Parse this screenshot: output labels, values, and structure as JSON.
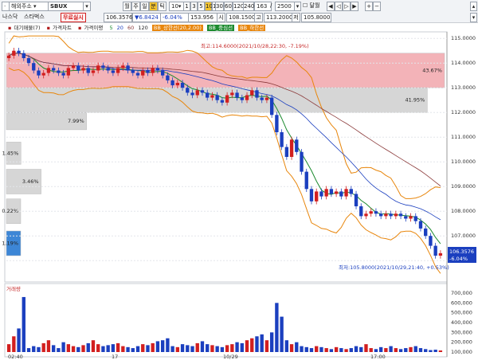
{
  "toolbar": {
    "market_label": "해외주소",
    "symbol": "SBUX",
    "period_buttons": [
      "월",
      "주",
      "일",
      "분",
      "틱"
    ],
    "interval_value": "10",
    "interval_options": [
      "1",
      "3",
      "5",
      "10",
      "15",
      "30",
      "60",
      "120",
      "240"
    ],
    "count_value": "163",
    "range_value": "2500",
    "overlay_label": "달월",
    "exchange_label": "나스닥",
    "name": "스타벅스",
    "free_realtime": "무료실시",
    "price": "106.3576",
    "change": "▼6.8424",
    "change_pct": "-6.04%",
    "volume": "153.956",
    "open_label": "시",
    "open": "108.1500",
    "high_label": "고",
    "high": "113.2000",
    "low_label": "저",
    "low": "105.8000"
  },
  "legend": {
    "items": [
      {
        "text": "대기매물(7)",
        "color": "#333333"
      },
      {
        "text": "가격차트",
        "color": "#333333"
      },
      {
        "text": "가격이평",
        "color": "#1b8a2e"
      },
      {
        "text": "5",
        "color": "#1b8a2e"
      },
      {
        "text": "20",
        "color": "#1b3fbf"
      },
      {
        "text": "60",
        "color": "#8b3a3a"
      },
      {
        "text": "120",
        "color": "#333333"
      },
      {
        "text": "BB_상한선(20,2.00)",
        "color": "#e8860c"
      },
      {
        "text": "BB_중심선",
        "color": "#1b8a2e"
      },
      {
        "text": "BB_하한선",
        "color": "#e8860c"
      }
    ]
  },
  "annotations": {
    "high": "최고:114.6000(2021/10/28,22:30, -7.19%)",
    "low": "최저:105.8000(2021/10/29,21:40, +0.53%)",
    "price_tag_1": "106.3576",
    "price_tag_2": "-6.04%"
  },
  "volume_label": "거래량",
  "chart_data": {
    "type": "candlestick",
    "price_axis": {
      "ticks": [
        115.0,
        114.0,
        113.0,
        112.0,
        111.0,
        110.0,
        109.0,
        108.0,
        107.0,
        106.0
      ]
    },
    "volume_axis": {
      "ticks": [
        "700,000",
        "600,000",
        "500,000",
        "400,000",
        "300,000",
        "200,000",
        "100,000"
      ]
    },
    "x_ticks": [
      "02:40",
      "17",
      "10/29",
      "17:00"
    ],
    "volume_profile": [
      {
        "price_from": 113.0,
        "price_to": 114.4,
        "pct": "43.67%"
      },
      {
        "price_from": 112.0,
        "price_to": 113.0,
        "pct": "41.95%"
      },
      {
        "price_from": 111.3,
        "price_to": 112.0,
        "pct": "7.99%"
      },
      {
        "price_from": 109.9,
        "price_to": 110.8,
        "pct": "1.45%"
      },
      {
        "price_from": 108.7,
        "price_to": 109.7,
        "pct": "3.46%"
      },
      {
        "price_from": 107.5,
        "price_to": 108.5,
        "pct": "0.22%"
      },
      {
        "price_from": 106.2,
        "price_to": 107.2,
        "pct": "1.19%"
      }
    ],
    "close": [
      114.3,
      114.5,
      114.4,
      114.2,
      114.0,
      113.7,
      113.5,
      113.6,
      113.8,
      113.7,
      113.6,
      113.5,
      113.8,
      113.9,
      113.7,
      113.8,
      113.6,
      113.7,
      113.9,
      113.8,
      113.7,
      113.6,
      113.8,
      113.9,
      113.7,
      113.6,
      113.5,
      113.7,
      113.6,
      113.8,
      113.7,
      113.5,
      113.3,
      113.1,
      113.2,
      113.0,
      112.8,
      112.7,
      112.9,
      112.8,
      112.6,
      112.7,
      112.5,
      112.4,
      112.7,
      112.8,
      112.6,
      112.5,
      112.7,
      112.9,
      112.6,
      112.5,
      112.6,
      111.9,
      111.2,
      110.6,
      110.2,
      110.9,
      110.4,
      109.6,
      108.9,
      108.4,
      108.8,
      108.6,
      108.9,
      108.7,
      108.8,
      108.6,
      108.9,
      108.7,
      108.2,
      107.8,
      107.9,
      108.0,
      107.9,
      107.8,
      107.9,
      107.8,
      107.9,
      107.8,
      107.7,
      107.8,
      107.6,
      107.3,
      107.0,
      106.6,
      106.2,
      106.3
    ],
    "volume": [
      40,
      80,
      120,
      280,
      20,
      30,
      25,
      45,
      60,
      35,
      20,
      50,
      40,
      30,
      25,
      35,
      45,
      60,
      40,
      30,
      35,
      40,
      45,
      30,
      25,
      20,
      30,
      40,
      35,
      45,
      55,
      60,
      70,
      30,
      25,
      40,
      35,
      30,
      45,
      55,
      40,
      35,
      30,
      25,
      35,
      40,
      50,
      45,
      60,
      70,
      80,
      90,
      60,
      100,
      250,
      180,
      60,
      40,
      50,
      30,
      25,
      20,
      30,
      25,
      20,
      15,
      25,
      20,
      15,
      20,
      30,
      25,
      40,
      20,
      15,
      25,
      20,
      30,
      20,
      15,
      20,
      25,
      30,
      20,
      15,
      10,
      12,
      8
    ]
  }
}
